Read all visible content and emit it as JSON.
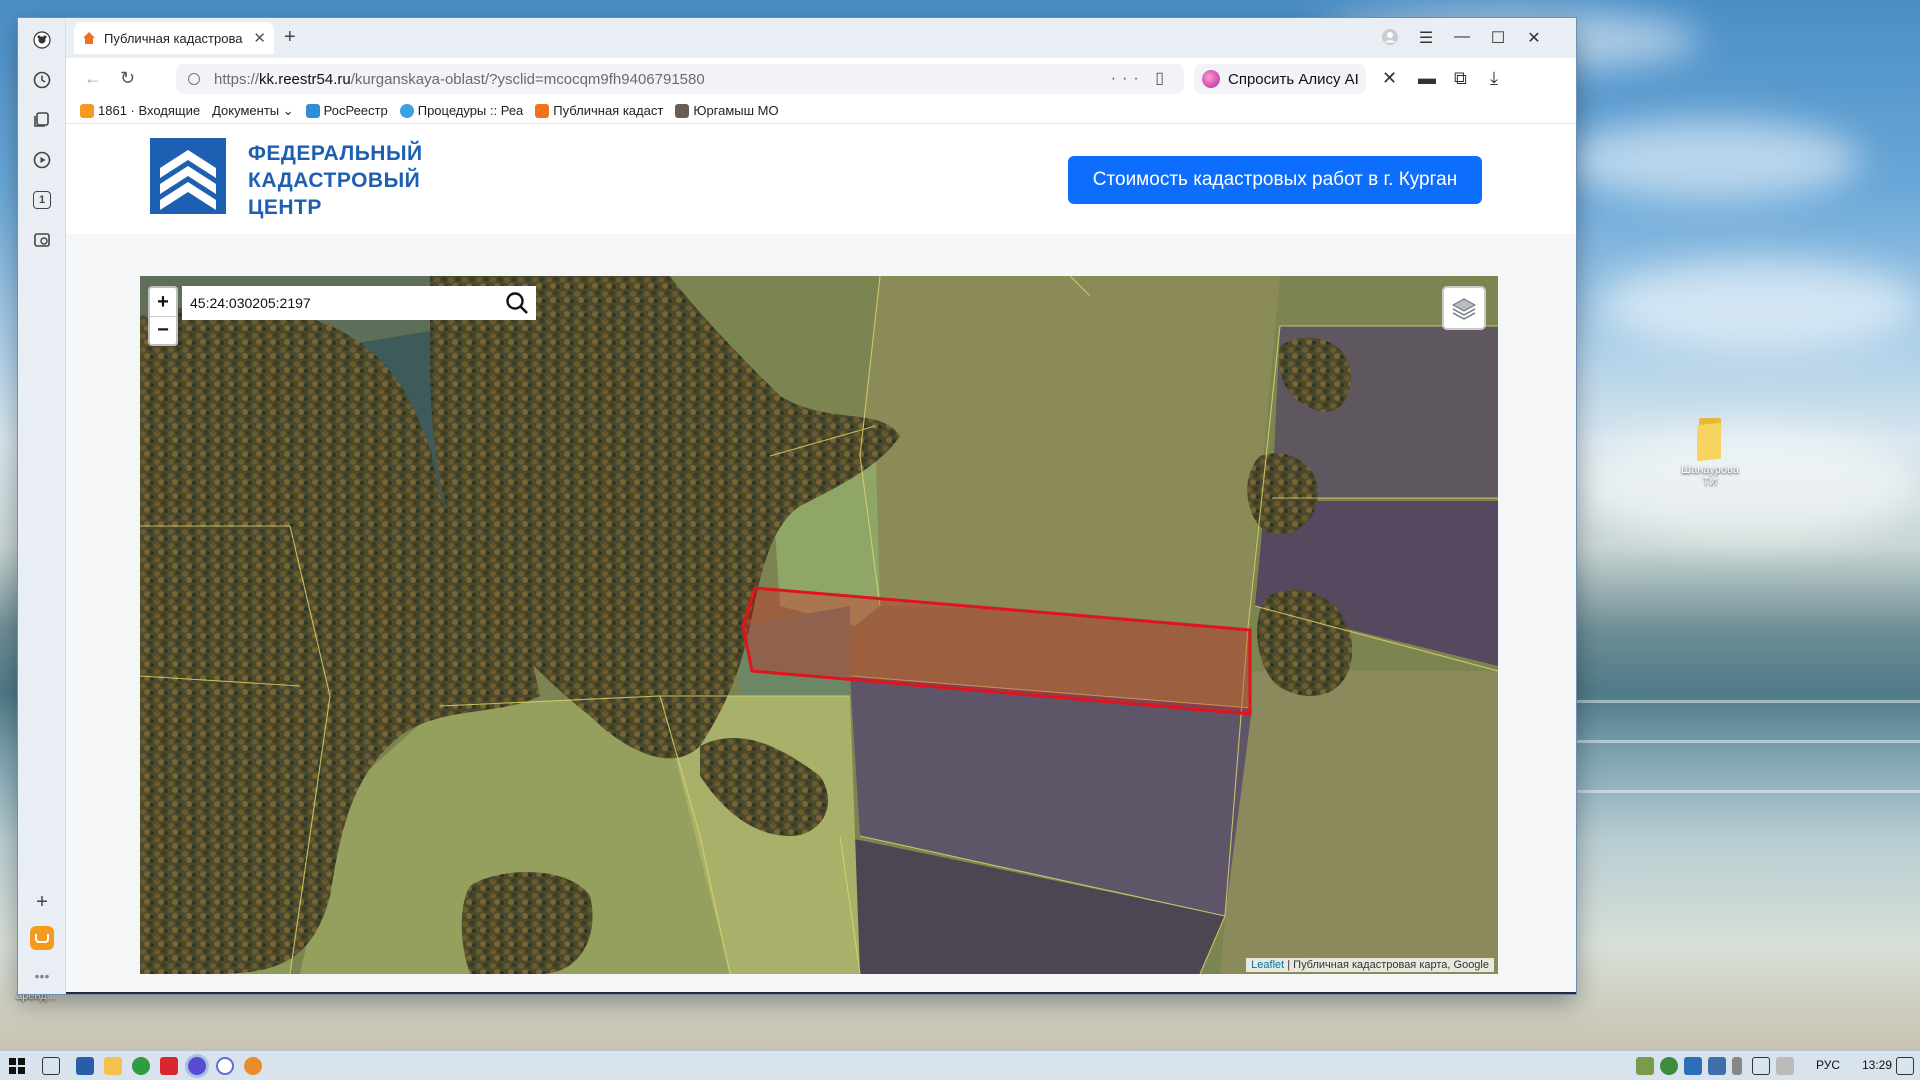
{
  "desktop": {
    "icon_label_line1": "Шанаурова",
    "icon_label_line2": "ТИ",
    "left_edge_label": "аренд..."
  },
  "browser": {
    "tab_title": "Публичная кадастрова",
    "url_scheme": "https://",
    "url_domain": "kk.reestr54.ru",
    "url_path": "/kurganskaya-oblast/?ysclid=mcocqm9fh9406791580",
    "alice_label": "Спросить Алису AI",
    "bookmarks": [
      {
        "label": "1861 · Входящие",
        "color": "#f59a1e"
      },
      {
        "label": "Документы ⌄",
        "color": ""
      },
      {
        "label": "РосРеестр",
        "color": "#2f8fd6"
      },
      {
        "label": "Процедуры :: Реа",
        "color": "#3aa0e0"
      },
      {
        "label": "Публичная кадаст",
        "color": "#f2711c"
      },
      {
        "label": "Юргамыш МО",
        "color": "#6b5d52"
      }
    ]
  },
  "site": {
    "logo_line1": "ФЕДЕРАЛЬНЫЙ",
    "logo_line2": "КАДАСТРОВЫЙ",
    "logo_line3": "ЦЕНТР",
    "cta_label": "Стоимость кадастровых работ в г. Курган",
    "brand_color": "#1d5fb3",
    "cta_color": "#0d6efd"
  },
  "map": {
    "zoom_in": "+",
    "zoom_out": "−",
    "search_value": "45:24:030205:2197",
    "attribution_link": "Leaflet",
    "attribution_text": " | Публичная кадастровая карта, Google",
    "highlight_color": "#e0141c"
  },
  "taskbar": {
    "lang": "РУС",
    "time": "13:29"
  }
}
